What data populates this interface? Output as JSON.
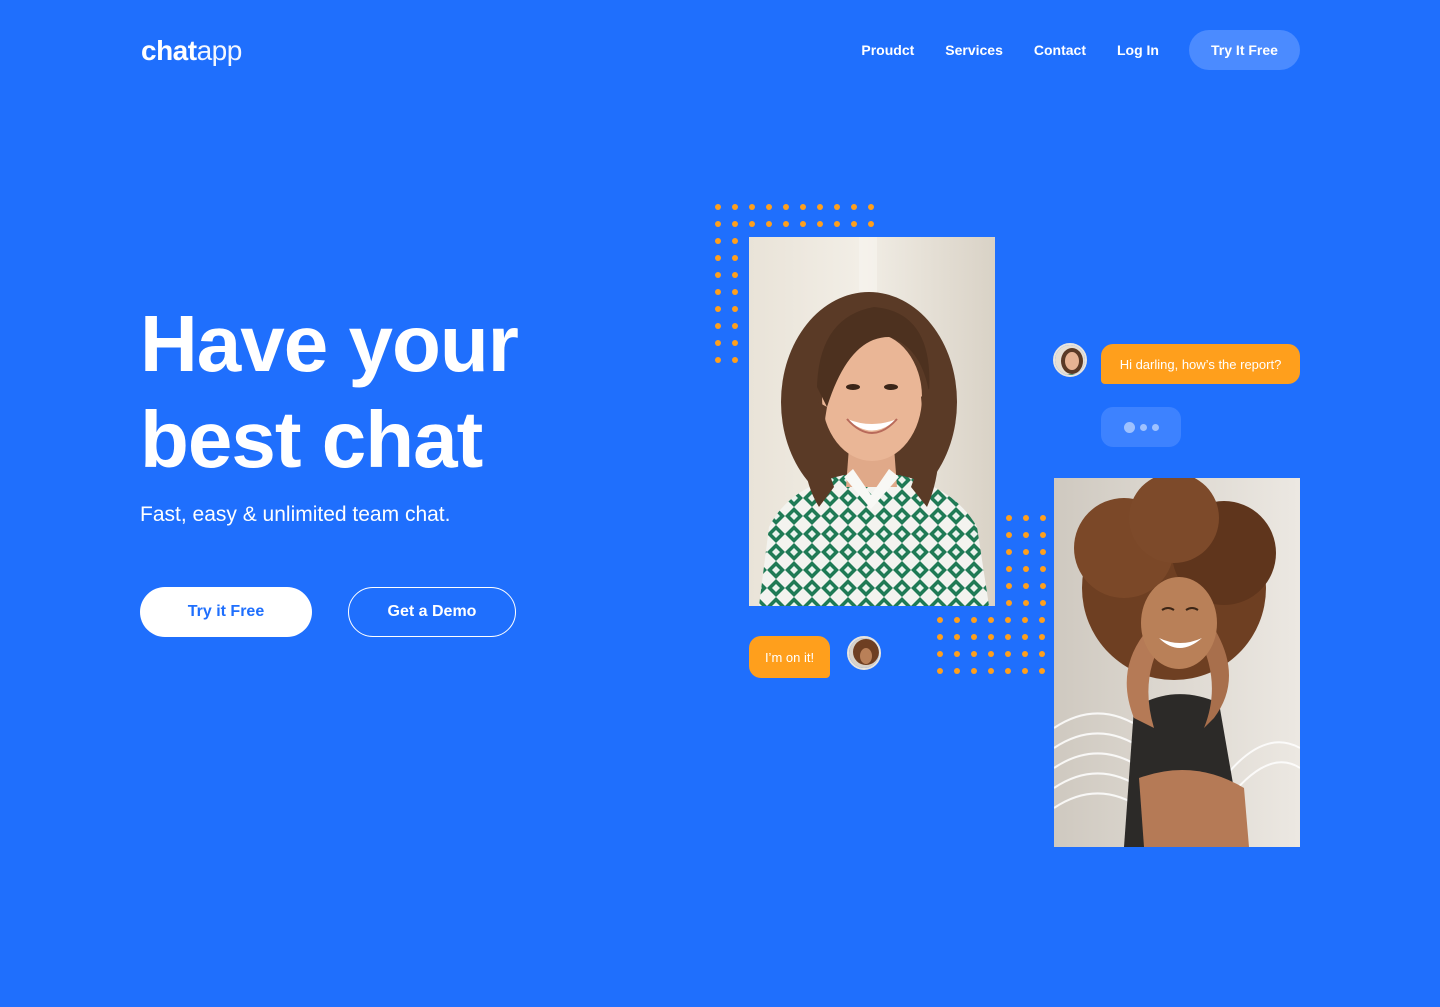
{
  "brand": {
    "logo_bold": "chat",
    "logo_light": "app"
  },
  "nav": {
    "links": [
      "Proudct",
      "Services",
      "Contact",
      "Log In"
    ],
    "cta": "Try It Free"
  },
  "hero": {
    "title_line1": "Have your",
    "title_line2": "best chat",
    "subtitle": "Fast, easy & unlimited team chat.",
    "primary_button": "Try it Free",
    "secondary_button": "Get a Demo"
  },
  "chat": {
    "incoming_message": "Hi darling, how’s the report?",
    "reply_message": "I’m on it!"
  },
  "colors": {
    "background": "#1f6ffd",
    "accent_orange": "#ff9f1c",
    "white": "#ffffff"
  },
  "icons": [
    "avatar-woman-1",
    "avatar-woman-2",
    "typing-indicator"
  ]
}
